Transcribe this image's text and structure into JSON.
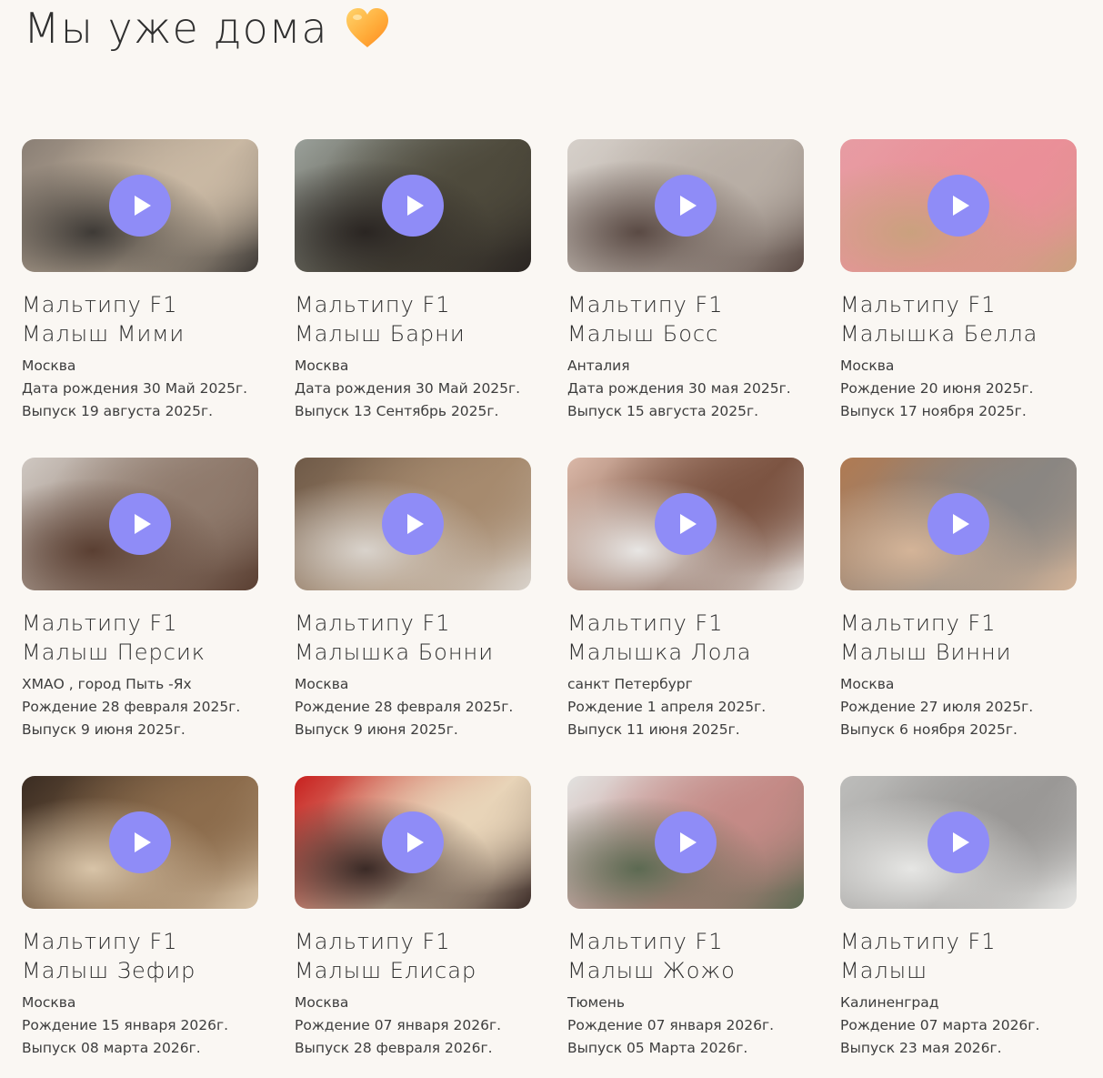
{
  "header": {
    "title": "Мы уже дома",
    "icon": "orange-heart-icon"
  },
  "colors": {
    "background": "#faf7f3",
    "play_button": "#8f8cf7",
    "text": "#2f2f2f"
  },
  "cards": [
    {
      "breed": "Мальтипу F1",
      "name": "Малыш Мими",
      "city": "Москва",
      "birth": "Дата рождения 30 Май 2025г.",
      "release": "Выпуск 19 августа 2025г.",
      "thumb_colors": [
        "#8a7f75",
        "#c9b8a3",
        "#3e3a36"
      ]
    },
    {
      "breed": "Мальтипу F1",
      "name": "Малыш Барни",
      "city": "Москва",
      "birth": "Дата рождения 30 Май 2025г.",
      "release": "Выпуск 13 Сентябрь 2025г.",
      "thumb_colors": [
        "#9aa09a",
        "#4e4a3c",
        "#2a2522"
      ]
    },
    {
      "breed": "Мальтипу F1",
      "name": "Малыш Босс",
      "city": "Анталия",
      "birth": "Дата рождения 30 мая 2025г.",
      "release": "Выпуск 15 августа 2025г.",
      "thumb_colors": [
        "#d6d0ca",
        "#b8aea5",
        "#5a4a44"
      ]
    },
    {
      "breed": "Мальтипу F1",
      "name": "Малышка Белла",
      "city": "Москва",
      "birth": "Рождение 20 июня 2025г.",
      "release": "Выпуск 17 ноября 2025г.",
      "thumb_colors": [
        "#e79ca3",
        "#ea8f98",
        "#caa17e"
      ]
    },
    {
      "breed": "Мальтипу F1",
      "name": "Малыш Персик",
      "city": "ХМАО , город Пыть -Ях",
      "birth": "Рождение 28 февраля 2025г.",
      "release": "Выпуск 9 июня 2025г.",
      "thumb_colors": [
        "#cfc8c2",
        "#8f7a6c",
        "#5a3f32"
      ]
    },
    {
      "breed": "Мальтипу F1",
      "name": "Малышка Бонни",
      "city": "Москва",
      "birth": "Рождение 28 февраля 2025г.",
      "release": "Выпуск 9 июня 2025г.",
      "thumb_colors": [
        "#6f5a48",
        "#a68a6e",
        "#d9d3cc"
      ]
    },
    {
      "breed": "Мальтипу F1",
      "name": "Малышка Лола",
      "city": "санкт Петербург",
      "birth": "Рождение 1 апреля 2025г.",
      "release": "Выпуск 11 июня 2025г.",
      "thumb_colors": [
        "#dab8a8",
        "#7c5442",
        "#e8e6e4"
      ]
    },
    {
      "breed": "Мальтипу F1",
      "name": "Малыш Винни",
      "city": "Москва",
      "birth": "Рождение 27 июля 2025г.",
      "release": "Выпуск 6 ноября 2025г.",
      "thumb_colors": [
        "#b07a52",
        "#8a8682",
        "#d4b498"
      ]
    },
    {
      "breed": "Мальтипу F1",
      "name": "Малыш Зефир",
      "city": "Москва",
      "birth": "Рождение 15 января 2026г.",
      "release": "Выпуск 08 марта 2026г.",
      "thumb_colors": [
        "#3a2c22",
        "#8c6c4c",
        "#d8c4a8"
      ]
    },
    {
      "breed": "Мальтипу F1",
      "name": "Малыш Елисар",
      "city": "Москва",
      "birth": "Рождение 07 января 2026г.",
      "release": "Выпуск 28 февраля 2026г.",
      "thumb_colors": [
        "#c8201e",
        "#e8d4b8",
        "#3a2a26"
      ]
    },
    {
      "breed": "Мальтипу F1",
      "name": "Малыш Жожо",
      "city": "Тюмень",
      "birth": "Рождение 07 января 2026г.",
      "release": "Выпуск 05 Марта 2026г.",
      "thumb_colors": [
        "#e2e2e0",
        "#c48a86",
        "#5c6a52"
      ]
    },
    {
      "breed": "Мальтипу F1",
      "name": "Малыш",
      "city": "Калиненград",
      "birth": "Рождение 07 марта 2026г.",
      "release": "Выпуск 23 мая 2026г.",
      "thumb_colors": [
        "#bdbdbb",
        "#9a9896",
        "#e6e6e4"
      ]
    }
  ]
}
